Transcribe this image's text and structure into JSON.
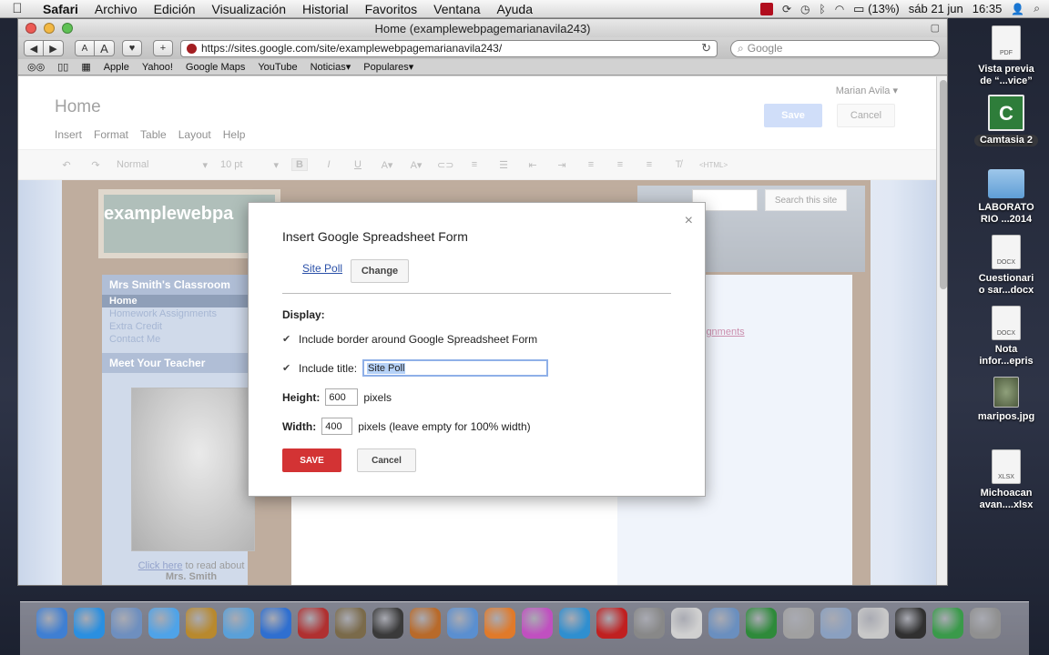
{
  "menubar": {
    "apple": "",
    "items": [
      "Safari",
      "Archivo",
      "Edición",
      "Visualización",
      "Historial",
      "Favoritos",
      "Ventana",
      "Ayuda"
    ],
    "battery": "(13%)",
    "date": "sáb 21 jun",
    "time": "16:35"
  },
  "window": {
    "title": "Home (examplewebpagemarianavila243)",
    "url": "https://sites.google.com/site/examplewebpagemarianavila243/",
    "search_placeholder": "Google",
    "toolbar_labels": {
      "back": "◀",
      "forward": "▶",
      "text_small": "A",
      "text_large": "A",
      "heart": "♥",
      "add": "+"
    }
  },
  "bookmarks": [
    "Apple",
    "Yahoo!",
    "Google Maps",
    "YouTube",
    "Noticias▾",
    "Populares▾"
  ],
  "sites_header": {
    "page_title": "Home",
    "user": "Marian Avila ▾",
    "save": "Save",
    "cancel": "Cancel",
    "menu": [
      "Insert",
      "Format",
      "Table",
      "Layout",
      "Help"
    ]
  },
  "format_bar": {
    "style": "Normal",
    "size": "10 pt",
    "html": "<HTML>"
  },
  "site": {
    "name": "examplewebpa",
    "search_button": "Search this site",
    "sidebar_heading": "Mrs Smith's Classroom",
    "nav": [
      "Home",
      "Homework Assignments",
      "Extra Credit",
      "Contact Me"
    ],
    "teacher_heading": "Meet Your Teacher",
    "caption_link": "Click here",
    "caption_rest": " to read about",
    "caption_name": "Mrs. Smith",
    "main_link": "ssignments"
  },
  "dialog": {
    "title": "Insert Google Spreadsheet Form",
    "form_name": "Site Poll",
    "change": "Change",
    "display_label": "Display:",
    "border_label": "Include border around Google Spreadsheet Form",
    "title_label": "Include title:",
    "title_value": "Site Poll",
    "height_label": "Height:",
    "height_value": "600",
    "height_unit": "pixels",
    "width_label": "Width:",
    "width_value": "400",
    "width_unit": "pixels (leave empty for 100% width)",
    "save": "SAVE",
    "cancel": "Cancel",
    "close": "×",
    "border_checked": true,
    "title_checked": true
  },
  "desktop": {
    "icons": [
      {
        "label1": "Vista previa",
        "label2": "de “...vice”",
        "kind": "PDF"
      },
      {
        "label1": "Camtasia 2",
        "label2": "",
        "kind": "C"
      },
      {
        "label1": "LABORATO",
        "label2": "RIO ...2014",
        "kind": "folder"
      },
      {
        "label1": "Cuestionari",
        "label2": "o sar...docx",
        "kind": "DOCX"
      },
      {
        "label1": "Nota",
        "label2": "infor...epris",
        "kind": "DOCX"
      },
      {
        "label1": "maripos.jpg",
        "label2": "",
        "kind": "photo"
      },
      {
        "label1": "Michoacan",
        "label2": "avan....xlsx",
        "kind": "XLSX"
      }
    ]
  },
  "dock": {
    "colors": [
      "#3f7fd2",
      "#2a8fe0",
      "#6e8fbf",
      "#4fa3e8",
      "#b8892e",
      "#5aa0d8",
      "#2f6fd0",
      "#b03030",
      "#7a6a4a",
      "#3a3a3a",
      "#b86a2a",
      "#5a8fd0",
      "#e07a2a",
      "#c050c0",
      "#2f8fd0",
      "#c02020",
      "#888888",
      "#d0d0d0",
      "#6a8fbf",
      "#2e8a3a",
      "#a0a0a0",
      "#8aa0c0",
      "#c8c8c8",
      "#303030",
      "#3a9a4a",
      "#909090"
    ]
  }
}
